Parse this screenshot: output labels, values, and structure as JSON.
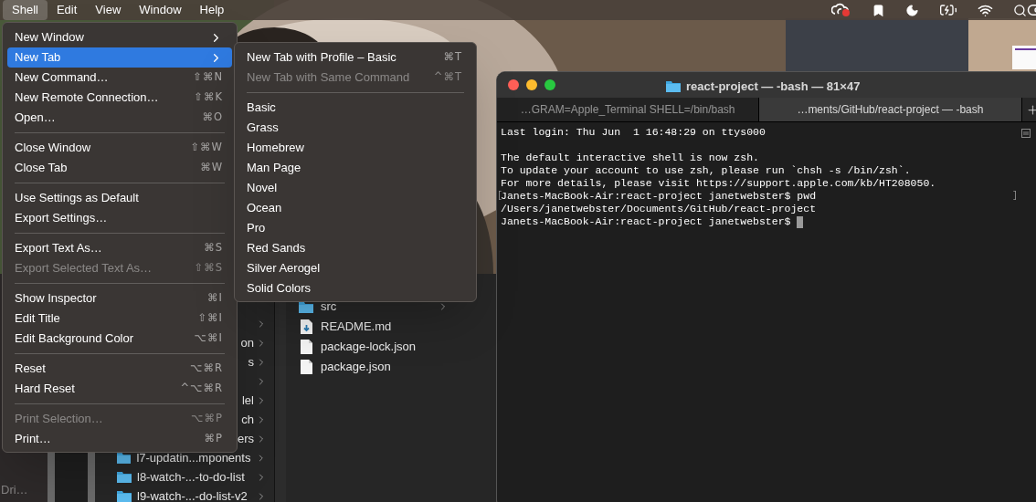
{
  "menu_bar": {
    "items": [
      {
        "label": "Shell",
        "selected": true
      },
      {
        "label": "Edit",
        "selected": false
      },
      {
        "label": "View",
        "selected": false
      },
      {
        "label": "Window",
        "selected": false
      },
      {
        "label": "Help",
        "selected": false
      }
    ]
  },
  "shell_menu": {
    "items": [
      {
        "kind": "item",
        "label": "New Window",
        "submenu": true,
        "disabled": false,
        "selected": false
      },
      {
        "kind": "item",
        "label": "New Tab",
        "submenu": true,
        "disabled": false,
        "selected": true
      },
      {
        "kind": "item",
        "label": "New Command…",
        "shortcut": "⇧⌘N",
        "submenu": false,
        "disabled": false,
        "selected": false
      },
      {
        "kind": "item",
        "label": "New Remote Connection…",
        "shortcut": "⇧⌘K",
        "submenu": false,
        "disabled": false,
        "selected": false
      },
      {
        "kind": "item",
        "label": "Open…",
        "shortcut": "⌘O",
        "submenu": false,
        "disabled": false,
        "selected": false
      },
      {
        "kind": "separator"
      },
      {
        "kind": "item",
        "label": "Close Window",
        "shortcut": "⇧⌘W",
        "submenu": false,
        "disabled": false,
        "selected": false
      },
      {
        "kind": "item",
        "label": "Close Tab",
        "shortcut": "⌘W",
        "submenu": false,
        "disabled": false,
        "selected": false
      },
      {
        "kind": "separator"
      },
      {
        "kind": "item",
        "label": "Use Settings as Default",
        "submenu": false,
        "disabled": false,
        "selected": false
      },
      {
        "kind": "item",
        "label": "Export Settings…",
        "submenu": false,
        "disabled": false,
        "selected": false
      },
      {
        "kind": "separator"
      },
      {
        "kind": "item",
        "label": "Export Text As…",
        "shortcut": "⌘S",
        "submenu": false,
        "disabled": false,
        "selected": false
      },
      {
        "kind": "item",
        "label": "Export Selected Text As…",
        "shortcut": "⇧⌘S",
        "submenu": false,
        "disabled": true,
        "selected": false
      },
      {
        "kind": "separator"
      },
      {
        "kind": "item",
        "label": "Show Inspector",
        "shortcut": "⌘I",
        "submenu": false,
        "disabled": false,
        "selected": false
      },
      {
        "kind": "item",
        "label": "Edit Title",
        "shortcut": "⇧⌘I",
        "submenu": false,
        "disabled": false,
        "selected": false
      },
      {
        "kind": "item",
        "label": "Edit Background Color",
        "shortcut": "⌥⌘I",
        "submenu": false,
        "disabled": false,
        "selected": false
      },
      {
        "kind": "separator"
      },
      {
        "kind": "item",
        "label": "Reset",
        "shortcut": "⌥⌘R",
        "submenu": false,
        "disabled": false,
        "selected": false
      },
      {
        "kind": "item",
        "label": "Hard Reset",
        "shortcut": "^⌥⌘R",
        "submenu": false,
        "disabled": false,
        "selected": false
      },
      {
        "kind": "separator"
      },
      {
        "kind": "item",
        "label": "Print Selection…",
        "shortcut": "⌥⌘P",
        "submenu": false,
        "disabled": true,
        "selected": false
      },
      {
        "kind": "item",
        "label": "Print…",
        "shortcut": "⌘P",
        "submenu": false,
        "disabled": false,
        "selected": false
      }
    ]
  },
  "new_tab_submenu": {
    "items": [
      {
        "kind": "item",
        "label": "New Tab with Profile – Basic",
        "shortcut": "⌘T",
        "disabled": false
      },
      {
        "kind": "item",
        "label": "New Tab with Same Command",
        "shortcut": "^⌘T",
        "disabled": true
      },
      {
        "kind": "separator"
      },
      {
        "kind": "item",
        "label": "Basic",
        "disabled": false
      },
      {
        "kind": "item",
        "label": "Grass",
        "disabled": false
      },
      {
        "kind": "item",
        "label": "Homebrew",
        "disabled": false
      },
      {
        "kind": "item",
        "label": "Man Page",
        "disabled": false
      },
      {
        "kind": "item",
        "label": "Novel",
        "disabled": false
      },
      {
        "kind": "item",
        "label": "Ocean",
        "disabled": false
      },
      {
        "kind": "item",
        "label": "Pro",
        "disabled": false
      },
      {
        "kind": "item",
        "label": "Red Sands",
        "disabled": false
      },
      {
        "kind": "item",
        "label": "Silver Aerogel",
        "disabled": false
      },
      {
        "kind": "item",
        "label": "Solid Colors",
        "disabled": false
      }
    ]
  },
  "finder": {
    "sidebar_item": "Dri…",
    "column_1": [
      {
        "kind": "fragment"
      },
      {
        "kind": "fragment",
        "name": "on"
      },
      {
        "kind": "fragment",
        "name": "s"
      },
      {
        "kind": "fragment"
      },
      {
        "kind": "fragment",
        "name": "lel"
      },
      {
        "kind": "fragment",
        "name": "ch"
      },
      {
        "kind": "fragment",
        "name": "ers"
      },
      {
        "kind": "folder",
        "name": "l7-updatin...mponents"
      },
      {
        "kind": "folder",
        "name": "l8-watch-...-to-do-list"
      },
      {
        "kind": "folder",
        "name": "l9-watch-...-do-list-v2"
      }
    ],
    "column_2": [
      {
        "kind": "folder",
        "name": "src"
      },
      {
        "kind": "markdown",
        "name": "README.md"
      },
      {
        "kind": "file",
        "name": "package-lock.json"
      },
      {
        "kind": "file",
        "name": "package.json"
      }
    ]
  },
  "terminal": {
    "title": "react-project — -bash — 81×47",
    "tabs": [
      {
        "label": "…GRAM=Apple_Terminal SHELL=/bin/bash",
        "selected": false
      },
      {
        "label": "…ments/GitHub/react-project — -bash",
        "selected": true
      }
    ],
    "lines": [
      {
        "kind": "text",
        "text": "Last login: Thu Jun  1 16:48:29 on ttys000",
        "marked": false,
        "cursor": false
      },
      {
        "kind": "blank"
      },
      {
        "kind": "text",
        "text": "The default interactive shell is now zsh.",
        "marked": false,
        "cursor": false
      },
      {
        "kind": "text",
        "text": "To update your account to use zsh, please run `chsh -s /bin/zsh`.",
        "marked": false,
        "cursor": false
      },
      {
        "kind": "text",
        "text": "For more details, please visit https://support.apple.com/kb/HT208050.",
        "marked": false,
        "cursor": false
      },
      {
        "kind": "text",
        "text": "Janets-MacBook-Air:react-project janetwebster$ pwd",
        "marked": true,
        "cursor": false
      },
      {
        "kind": "text",
        "text": "/Users/janetwebster/Documents/GitHub/react-project",
        "marked": false,
        "cursor": false
      },
      {
        "kind": "text",
        "text": "Janets-MacBook-Air:react-project janetwebster$ ",
        "marked": false,
        "cursor": true
      }
    ],
    "mark_left": "[",
    "mark_right": "]"
  }
}
